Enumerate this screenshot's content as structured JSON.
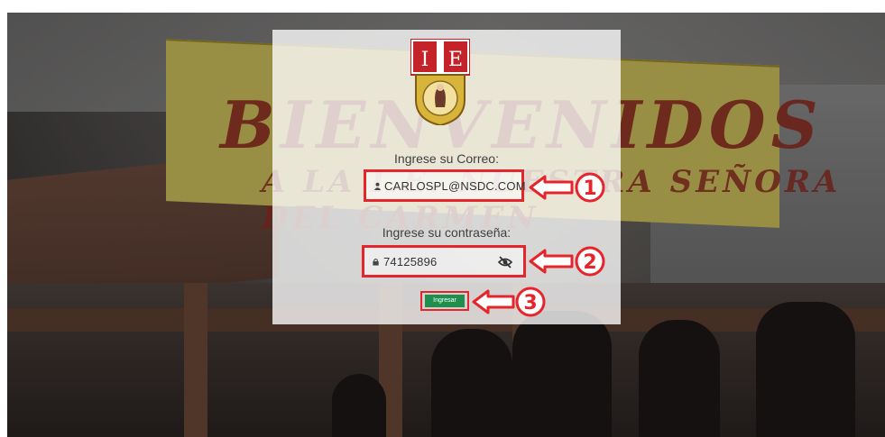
{
  "school_logo": {
    "left_letter": "I",
    "right_letter": "E"
  },
  "background_banner": {
    "line1": "BIENVENIDOS",
    "line2": "A LA I.E. NUESTRA SEÑORA DEL CARMEN"
  },
  "login": {
    "email_label": "Ingrese su Correo:",
    "email_value": "CARLOSPL@NSDC.COM",
    "password_label": "Ingrese su contraseña:",
    "password_value": "74125896",
    "submit_label": "Ingresar"
  },
  "annotations": {
    "step1": "1",
    "step2": "2",
    "step3": "3"
  },
  "colors": {
    "highlight": "#e5252b",
    "submit": "#1f8f4e",
    "card": "#ffffff"
  }
}
